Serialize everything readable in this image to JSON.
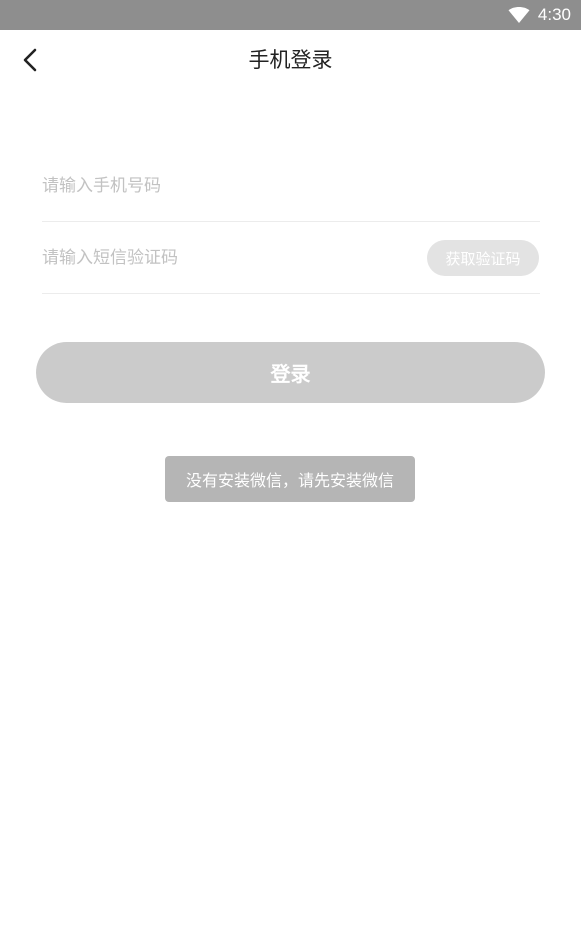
{
  "status_bar": {
    "time": "4:30",
    "wifi_icon": "wifi-icon"
  },
  "header": {
    "back_icon": "chevron-left-icon",
    "title": "手机登录"
  },
  "form": {
    "phone_placeholder": "请输入手机号码",
    "phone_value": "",
    "code_placeholder": "请输入短信验证码",
    "code_value": "",
    "get_code_label": "获取验证码",
    "login_label": "登录"
  },
  "toast": {
    "message": "没有安装微信，请先安装微信"
  },
  "colors": {
    "status_bar_bg": "#8e8e8e",
    "login_button_bg": "#cbcbcb",
    "get_code_bg": "#e3e3e3",
    "toast_bg": "#b5b5b5",
    "divider": "#ececec",
    "placeholder_text": "#c2c2c2"
  }
}
